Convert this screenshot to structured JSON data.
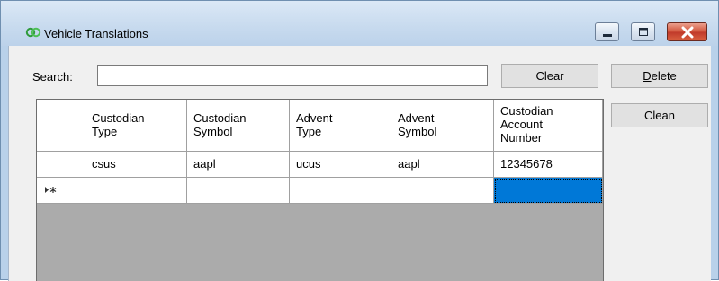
{
  "window": {
    "title": "Vehicle Translations",
    "icon": "vehicle-rings-icon",
    "controls": [
      "minimize-icon",
      "maximize-icon",
      "close-icon"
    ]
  },
  "search": {
    "label": "Search:",
    "value": "",
    "placeholder": ""
  },
  "buttons": {
    "clear": "Clear",
    "delete_mnemonic": "D",
    "delete_rest": "elete",
    "clean": "Clean"
  },
  "grid": {
    "columns": [
      {
        "line1": "Custodian",
        "line2": "Type",
        "line3": ""
      },
      {
        "line1": "Custodian",
        "line2": "Symbol",
        "line3": ""
      },
      {
        "line1": "Advent",
        "line2": "Type",
        "line3": ""
      },
      {
        "line1": "Advent",
        "line2": "Symbol",
        "line3": ""
      },
      {
        "line1": "Custodian",
        "line2": "Account",
        "line3": "Number"
      }
    ],
    "rows": [
      [
        "csus",
        "aapl",
        "ucus",
        "aapl",
        "12345678"
      ]
    ],
    "new_row_glyph": "▸*",
    "colors": {
      "selection": "#0078d7",
      "empty_area": "#ababab"
    }
  }
}
